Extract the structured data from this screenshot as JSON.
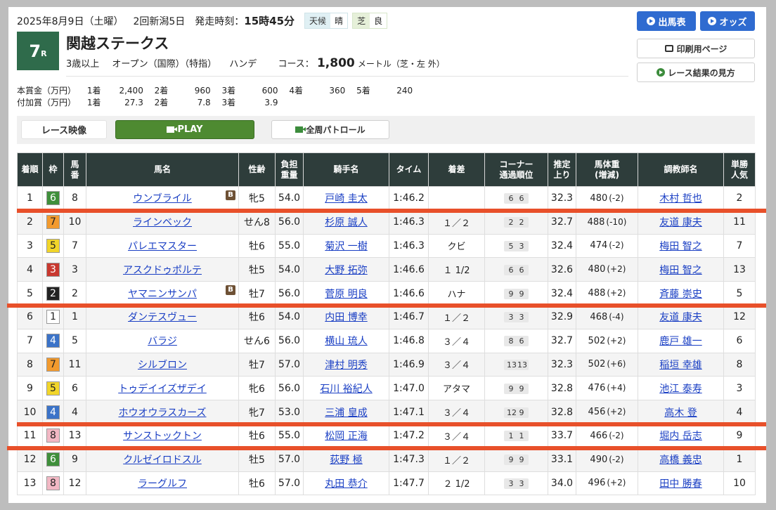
{
  "header": {
    "date": "2025年8月9日（土曜）",
    "meeting": "2回新潟5日",
    "post_time_label": "発走時刻：",
    "post_time": "15時45分",
    "weather_label": "天候",
    "weather": "晴",
    "track_type": "芝",
    "track_condition": "良"
  },
  "race": {
    "number": "7",
    "number_suffix": "R",
    "name": "関越ステークス",
    "age": "3歳以上",
    "class": "オープン（国際）（特指）",
    "weight_rule": "ハンデ",
    "course_label": "コース：",
    "distance": "1,800",
    "distance_unit": "メートル（芝・左 外）"
  },
  "buttons": {
    "entries": "出馬表",
    "odds": "オッズ",
    "print": "印刷用ページ",
    "howto": "レース結果の見方"
  },
  "prizes": {
    "main_label": "本賞金（万円）",
    "main": [
      {
        "place": "1着",
        "amount": "2,400"
      },
      {
        "place": "2着",
        "amount": "960"
      },
      {
        "place": "3着",
        "amount": "600"
      },
      {
        "place": "4着",
        "amount": "360"
      },
      {
        "place": "5着",
        "amount": "240"
      }
    ],
    "extra_label": "付加賞（万円）",
    "extra": [
      {
        "place": "1着",
        "amount": "27.3"
      },
      {
        "place": "2着",
        "amount": "7.8"
      },
      {
        "place": "3着",
        "amount": "3.9"
      }
    ]
  },
  "video": {
    "label": "レース映像",
    "play": "PLAY",
    "patrol": "全周パトロール"
  },
  "table": {
    "headers": {
      "rank": "着順",
      "waku": "枠",
      "umaban_1": "馬",
      "umaban_2": "番",
      "horse": "馬名",
      "sex_age": "性齢",
      "weight_1": "負担",
      "weight_2": "重量",
      "jockey": "騎手名",
      "time": "タイム",
      "margin": "着差",
      "corner_1": "コーナー",
      "corner_2": "通過順位",
      "last3f_1": "推定",
      "last3f_2": "上り",
      "body_1": "馬体重",
      "body_2": "(増減)",
      "trainer": "調教師名",
      "pop_1": "単勝",
      "pop_2": "人気"
    },
    "rows": [
      {
        "rank": "1",
        "waku": "6",
        "umaban": "8",
        "horse": "ウンブライル",
        "blinker": "B",
        "sex_age": "牝5",
        "weight": "54.0",
        "jockey": "戸崎 圭太",
        "time": "1:46.2",
        "margin": "",
        "c1": "6",
        "c2": "6",
        "last3f": "32.3",
        "body": "480",
        "diff": "(-2)",
        "trainer": "木村 哲也",
        "pop": "2"
      },
      {
        "rank": "2",
        "waku": "7",
        "umaban": "10",
        "horse": "ラインベック",
        "blinker": "",
        "sex_age": "せん8",
        "weight": "56.0",
        "jockey": "杉原 誠人",
        "time": "1:46.3",
        "margin": "１／２",
        "c1": "2",
        "c2": "2",
        "last3f": "32.7",
        "body": "488",
        "diff": "(-10)",
        "trainer": "友道 康夫",
        "pop": "11"
      },
      {
        "rank": "3",
        "waku": "5",
        "umaban": "7",
        "horse": "パレエマスター",
        "blinker": "",
        "sex_age": "牡6",
        "weight": "55.0",
        "jockey": "菊沢 一樹",
        "time": "1:46.3",
        "margin": "クビ",
        "c1": "5",
        "c2": "3",
        "last3f": "32.4",
        "body": "474",
        "diff": "(-2)",
        "trainer": "梅田 智之",
        "pop": "7"
      },
      {
        "rank": "4",
        "waku": "3",
        "umaban": "3",
        "horse": "アスクドゥポルテ",
        "blinker": "",
        "sex_age": "牡5",
        "weight": "54.0",
        "jockey": "大野 拓弥",
        "time": "1:46.6",
        "margin": "１ 1/2",
        "c1": "6",
        "c2": "6",
        "last3f": "32.6",
        "body": "480",
        "diff": "(+2)",
        "trainer": "梅田 智之",
        "pop": "13"
      },
      {
        "rank": "5",
        "waku": "2",
        "umaban": "2",
        "horse": "ヤマニンサンパ",
        "blinker": "B",
        "sex_age": "牡7",
        "weight": "56.0",
        "jockey": "菅原 明良",
        "time": "1:46.6",
        "margin": "ハナ",
        "c1": "9",
        "c2": "9",
        "last3f": "32.4",
        "body": "488",
        "diff": "(+2)",
        "trainer": "斉藤 崇史",
        "pop": "5"
      },
      {
        "rank": "6",
        "waku": "1",
        "umaban": "1",
        "horse": "ダンテスヴュー",
        "blinker": "",
        "sex_age": "牡6",
        "weight": "54.0",
        "jockey": "内田 博幸",
        "time": "1:46.7",
        "margin": "１／２",
        "c1": "3",
        "c2": "3",
        "last3f": "32.9",
        "body": "468",
        "diff": "(-4)",
        "trainer": "友道 康夫",
        "pop": "12"
      },
      {
        "rank": "7",
        "waku": "4",
        "umaban": "5",
        "horse": "バラジ",
        "blinker": "",
        "sex_age": "せん6",
        "weight": "56.0",
        "jockey": "横山 琉人",
        "time": "1:46.8",
        "margin": "３／４",
        "c1": "8",
        "c2": "6",
        "last3f": "32.7",
        "body": "502",
        "diff": "(+2)",
        "trainer": "鹿戸 雄一",
        "pop": "6"
      },
      {
        "rank": "8",
        "waku": "7",
        "umaban": "11",
        "horse": "シルブロン",
        "blinker": "",
        "sex_age": "牡7",
        "weight": "57.0",
        "jockey": "津村 明秀",
        "time": "1:46.9",
        "margin": "３／４",
        "c1": "13",
        "c2": "13",
        "last3f": "32.3",
        "body": "502",
        "diff": "(+6)",
        "trainer": "稲垣 幸雄",
        "pop": "8"
      },
      {
        "rank": "9",
        "waku": "5",
        "umaban": "6",
        "horse": "トゥデイイズザデイ",
        "blinker": "",
        "sex_age": "牝6",
        "weight": "56.0",
        "jockey": "石川 裕紀人",
        "time": "1:47.0",
        "margin": "アタマ",
        "c1": "9",
        "c2": "9",
        "last3f": "32.8",
        "body": "476",
        "diff": "(+4)",
        "trainer": "池江 泰寿",
        "pop": "3"
      },
      {
        "rank": "10",
        "waku": "4",
        "umaban": "4",
        "horse": "ホウオウラスカーズ",
        "blinker": "",
        "sex_age": "牝7",
        "weight": "53.0",
        "jockey": "三浦 皇成",
        "time": "1:47.1",
        "margin": "３／４",
        "c1": "12",
        "c2": "9",
        "last3f": "32.8",
        "body": "456",
        "diff": "(+2)",
        "trainer": "高木 登",
        "pop": "4"
      },
      {
        "rank": "11",
        "waku": "8",
        "umaban": "13",
        "horse": "サンストックトン",
        "blinker": "",
        "sex_age": "牡6",
        "weight": "55.0",
        "jockey": "松岡 正海",
        "time": "1:47.2",
        "margin": "３／４",
        "c1": "1",
        "c2": "1",
        "last3f": "33.7",
        "body": "466",
        "diff": "(-2)",
        "trainer": "堀内 岳志",
        "pop": "9"
      },
      {
        "rank": "12",
        "waku": "6",
        "umaban": "9",
        "horse": "クルゼイロドスル",
        "blinker": "",
        "sex_age": "牡5",
        "weight": "57.0",
        "jockey": "荻野 極",
        "time": "1:47.3",
        "margin": "１／２",
        "c1": "9",
        "c2": "9",
        "last3f": "33.1",
        "body": "490",
        "diff": "(-2)",
        "trainer": "高橋 義忠",
        "pop": "1"
      },
      {
        "rank": "13",
        "waku": "8",
        "umaban": "12",
        "horse": "ラーグルフ",
        "blinker": "",
        "sex_age": "牡6",
        "weight": "57.0",
        "jockey": "丸田 恭介",
        "time": "1:47.7",
        "margin": "２ 1/2",
        "c1": "3",
        "c2": "3",
        "last3f": "34.0",
        "body": "496",
        "diff": "(+2)",
        "trainer": "田中 勝春",
        "pop": "10"
      }
    ]
  },
  "colors": {
    "race_badge": "#2f6b4b",
    "header_bg": "#2e3d3b",
    "link": "#1a3fc4",
    "play_button": "#4e8a31",
    "blue_button": "#2f6bd0",
    "annotation_line": "#e8502a",
    "waku": {
      "1": {
        "bg": "#ffffff",
        "fg": "#222222"
      },
      "2": {
        "bg": "#222222",
        "fg": "#ffffff"
      },
      "3": {
        "bg": "#c8382f",
        "fg": "#ffffff"
      },
      "4": {
        "bg": "#3b73c8",
        "fg": "#ffffff"
      },
      "5": {
        "bg": "#f1d52a",
        "fg": "#222222"
      },
      "6": {
        "bg": "#3f8f3b",
        "fg": "#ffffff"
      },
      "7": {
        "bg": "#f29a2e",
        "fg": "#222222"
      },
      "8": {
        "bg": "#f2b8c4",
        "fg": "#222222"
      }
    }
  },
  "annotations": {
    "underlined_after_ranks": [
      "1",
      "5",
      "10",
      "11"
    ]
  }
}
